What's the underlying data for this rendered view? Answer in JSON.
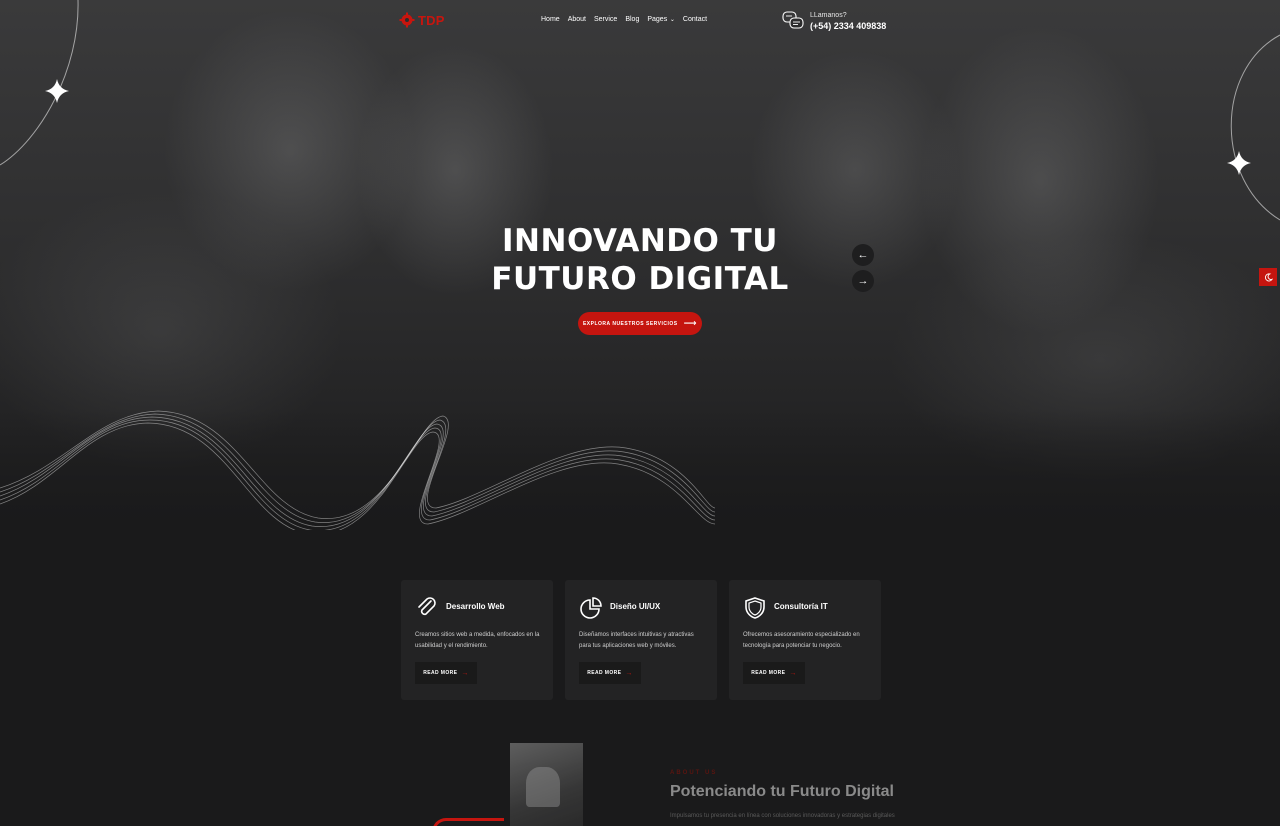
{
  "brand": {
    "name": "TDP",
    "accent": "#c5150f",
    "icon": "gear-logo-icon"
  },
  "nav": {
    "items": [
      {
        "label": "Home"
      },
      {
        "label": "About"
      },
      {
        "label": "Service"
      },
      {
        "label": "Blog"
      },
      {
        "label": "Pages",
        "has_dropdown": true
      },
      {
        "label": "Contact"
      }
    ],
    "call": {
      "icon": "chat-bubbles-icon",
      "label": "LLamanos?",
      "phone": "(+54) 2334 409838"
    }
  },
  "hero": {
    "title_line1": "INNOVANDO TU",
    "title_line2": "FUTURO DIGITAL",
    "cta_label": "EXPLORA NUESTROS SERVICIOS",
    "cta_icon": "long-arrow-right-icon",
    "prev_icon": "←",
    "next_icon": "→",
    "mode_toggle_icon": "moon-icon"
  },
  "services": [
    {
      "icon": "paperclip-icon",
      "title": "Desarrollo Web",
      "description": "Creamos sitios web a medida, enfocados en la usabilidad y el rendimiento.",
      "button": "READ MORE"
    },
    {
      "icon": "pie-chart-icon",
      "title": "Diseño UI/UX",
      "description": "Diseñamos interfaces intuitivas y atractivas para tus aplicaciones web y móviles.",
      "button": "READ MORE"
    },
    {
      "icon": "shield-icon",
      "title": "Consultoría IT",
      "description": "Ofrecemos asesoramiento especializado en tecnología para potenciar tu negocio.",
      "button": "READ MORE"
    }
  ],
  "about": {
    "kicker": "ABOUT US",
    "title": "Potenciando tu Futuro Digital",
    "text": "Impulsamos tu presencia en línea con soluciones innovadoras y estrategias digitales"
  }
}
